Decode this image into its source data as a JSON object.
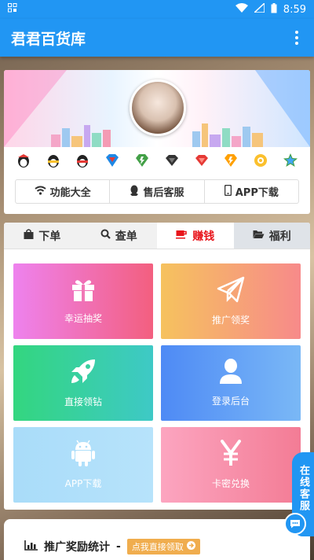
{
  "status_bar": {
    "time": "8:59"
  },
  "app_bar": {
    "title": "君君百货库"
  },
  "function_buttons": [
    {
      "label": "功能大全",
      "icon": "wifi-icon"
    },
    {
      "label": "售后客服",
      "icon": "qq-penguin-icon"
    },
    {
      "label": "APP下载",
      "icon": "mobile-phone-icon"
    }
  ],
  "tabs": [
    {
      "label": "下单",
      "icon": "shopping-bag-icon"
    },
    {
      "label": "查单",
      "icon": "search-icon"
    },
    {
      "label": "赚钱",
      "icon": "coffee-cup-icon"
    },
    {
      "label": "福利",
      "icon": "folder-open-icon"
    }
  ],
  "tiles": [
    {
      "label": "幸运抽奖",
      "icon": "gift-icon",
      "gradient": [
        "#ee82ee",
        "#f35f7f"
      ]
    },
    {
      "label": "推广领奖",
      "icon": "paper-plane-icon",
      "gradient": [
        "#f6c25e",
        "#f78a8a"
      ]
    },
    {
      "label": "直接领钻",
      "icon": "rocket-icon",
      "gradient": [
        "#33d67f",
        "#3ec9c6"
      ]
    },
    {
      "label": "登录后台",
      "icon": "user-icon",
      "gradient": [
        "#4e8af5",
        "#7ab8f6"
      ]
    },
    {
      "label": "APP下载",
      "icon": "android-icon",
      "gradient": [
        "#a9dcf9",
        "#b7e3fb"
      ]
    },
    {
      "label": "卡密兑换",
      "icon": "yen-icon",
      "gradient": [
        "#fca5c0",
        "#f37c95"
      ]
    }
  ],
  "stats": {
    "title": "推广奖励统计",
    "separator": "-",
    "button_label": "点我直接领取"
  },
  "float_service": {
    "label": "在线客服"
  },
  "colors": {
    "primary": "#2196f3",
    "active_tab": "#e8141a",
    "stats_button": "#f0ad4e"
  }
}
